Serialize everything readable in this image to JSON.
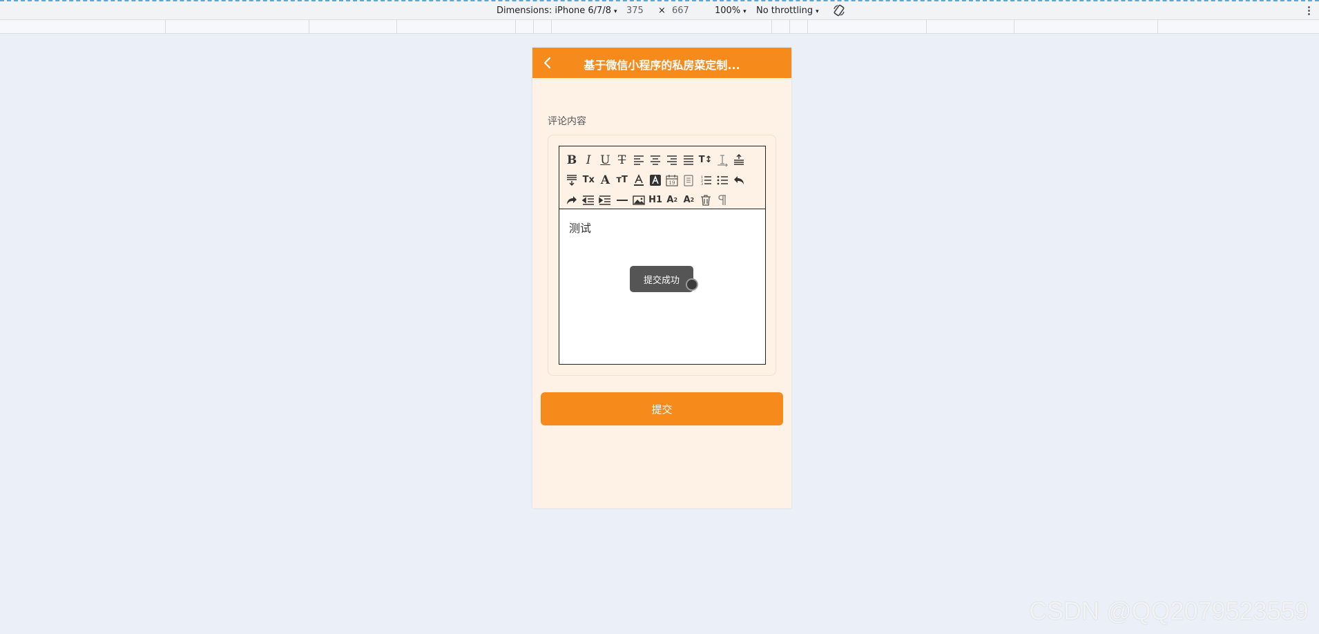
{
  "devtools": {
    "dimensions_label": "Dimensions: iPhone 6/7/8",
    "width": "375",
    "times": "×",
    "height": "667",
    "zoom": "100%",
    "throttling": "No throttling",
    "caret": "▾"
  },
  "nav": {
    "title": "基于微信小程序的私房菜定制...",
    "background_color": "#f68a1b"
  },
  "form": {
    "field_label": "评论内容",
    "editor_content": "测试",
    "submit_label": "提交"
  },
  "toolbar": {
    "buttons": [
      "bold",
      "italic",
      "underline",
      "strikethrough",
      "align-left",
      "align-center",
      "align-right",
      "align-justify",
      "font-size",
      "line-height",
      "space-before",
      "space-after",
      "remove-format",
      "font-family",
      "text-size",
      "font-color",
      "background-color",
      "date",
      "clipboard",
      "ordered-list",
      "bullet-list",
      "undo",
      "redo",
      "outdent",
      "indent",
      "horizontal-rule",
      "image",
      "header-1",
      "subscript",
      "superscript",
      "clear",
      "direction"
    ],
    "h1_label": "H1"
  },
  "toast": {
    "text": "提交成功"
  },
  "watermark": "CSDN @QQ2079523559"
}
